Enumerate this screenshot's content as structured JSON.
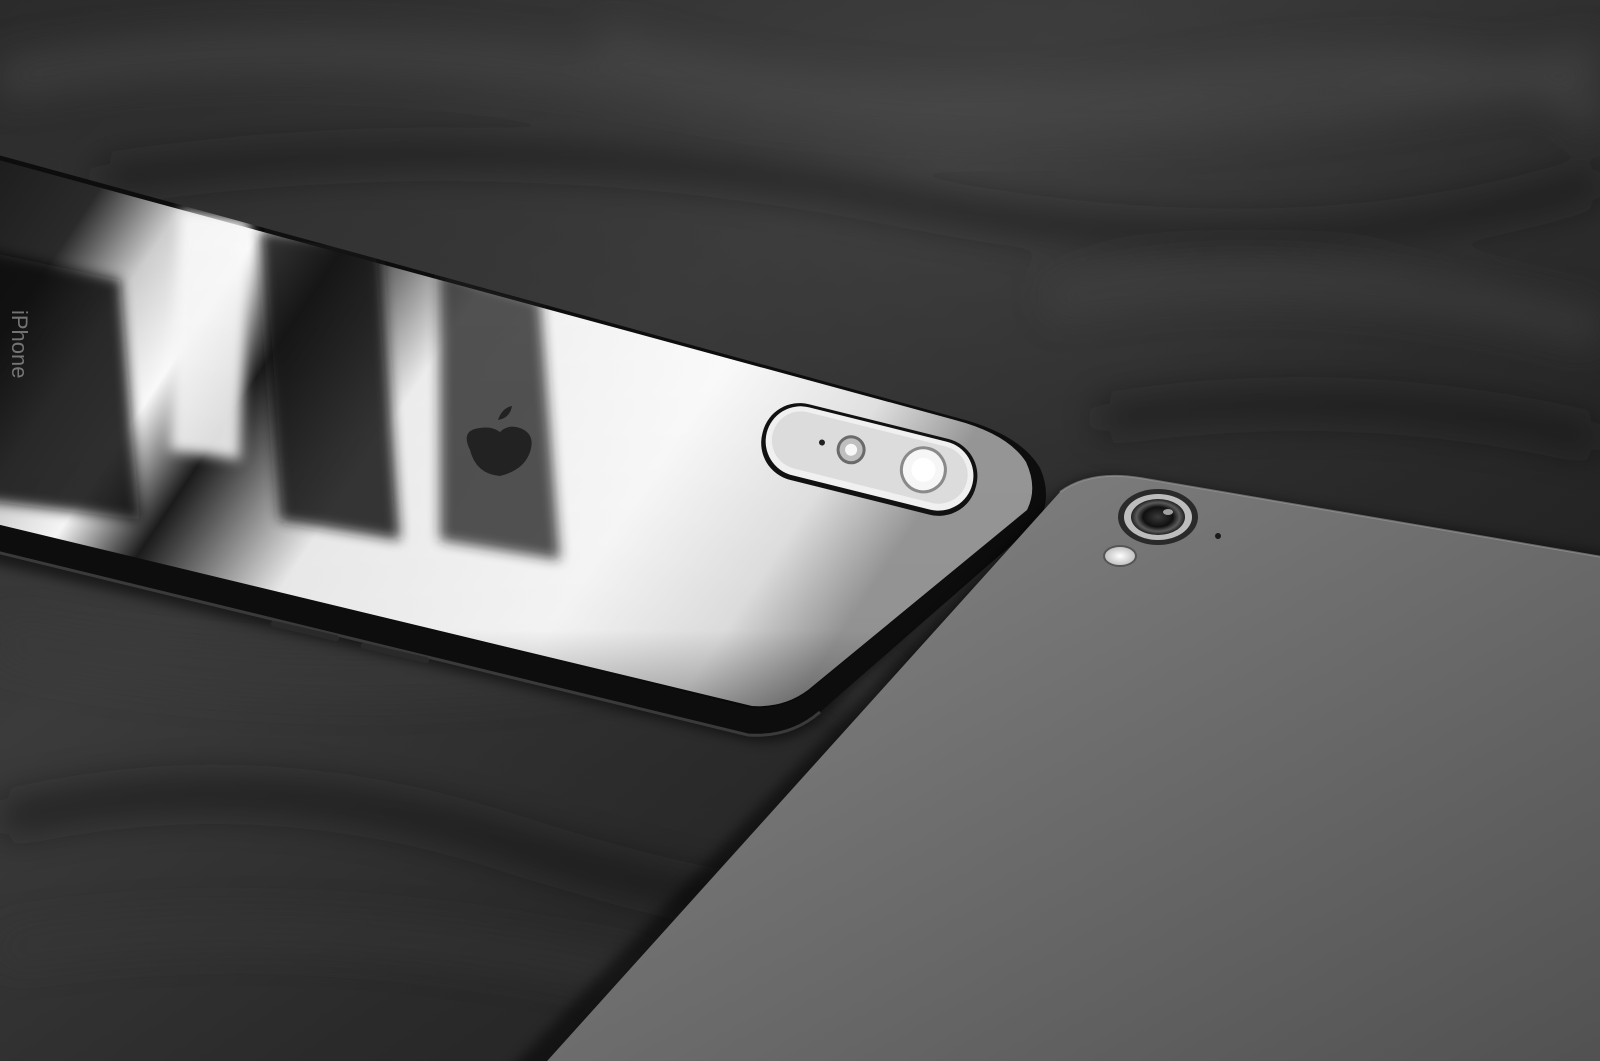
{
  "photo": {
    "subject_icons": [
      "phone-glossy-back-icon",
      "phone-matte-back-icon",
      "dual-camera-module-icon",
      "single-camera-lens-icon",
      "apple-logo-icon"
    ],
    "palette": {
      "background": "#232323",
      "fabric_highlight": "#3a3a3a",
      "glossy_phone_highlight": "#ffffff",
      "glossy_phone_dark": "#0d0d0d",
      "matte_phone": "#6e6e6e",
      "matte_phone_shadow": "#3e3e3e"
    },
    "printed_text": {
      "glossy_phone_edge_text": "iPhone"
    }
  }
}
